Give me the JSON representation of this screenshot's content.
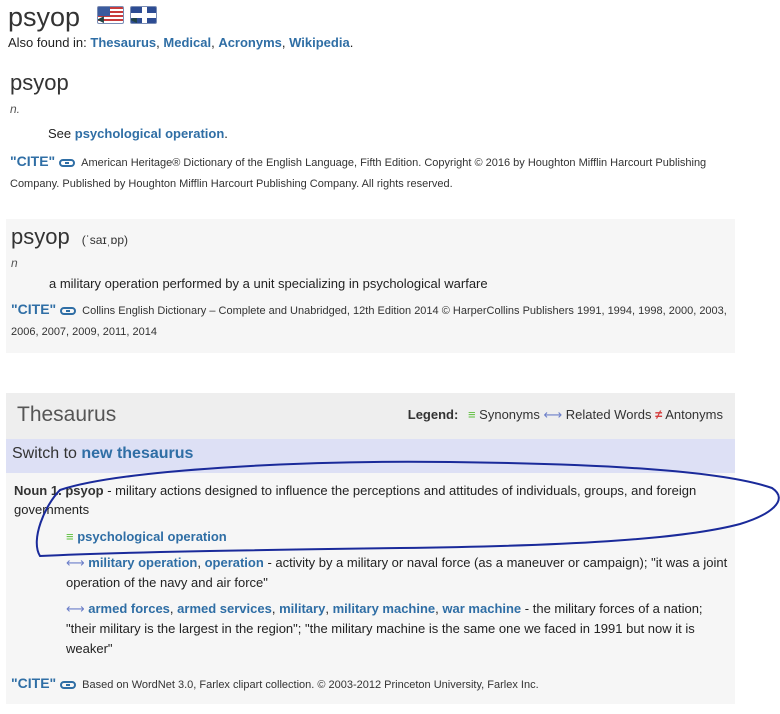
{
  "word": "psyop",
  "also_found": {
    "prefix": "Also found in:",
    "links": [
      "Thesaurus",
      "Medical",
      "Acronyms",
      "Wikipedia"
    ],
    "sep": ", ",
    "end": "."
  },
  "entry_ahd": {
    "headword": "psyop",
    "pos": "n.",
    "def_prefix": "See",
    "def_link": "psychological operation",
    "def_end": ".",
    "cite_label": "\"CITE\"",
    "cite_text": "American Heritage® Dictionary of the English Language, Fifth Edition. Copyright © 2016 by Houghton Mifflin Harcourt Publishing Company. Published by Houghton Mifflin Harcourt Publishing Company. All rights reserved."
  },
  "entry_collins": {
    "headword": "psyop",
    "pron": "(ˈsaɪˌɒp)",
    "pos": "n",
    "def": "a military operation performed by a unit specializing in psychological warfare",
    "cite_label": "\"CITE\"",
    "cite_text": "Collins English Dictionary – Complete and Unabridged, 12th Edition 2014 © HarperCollins Publishers 1991, 1994, 1998, 2000, 2003, 2006, 2007, 2009, 2011, 2014"
  },
  "thesaurus": {
    "title": "Thesaurus",
    "legend_label": "Legend:",
    "synonyms": "Synonyms",
    "related": "Related Words",
    "antonyms": "Antonyms",
    "switch_prefix": "Switch to",
    "switch_link": "new thesaurus",
    "sense_label": "Noun",
    "sense_num": "1.",
    "sense_word": "psyop",
    "sense_def": "- military actions designed to influence the perceptions and attitudes of individuals, groups, and foreign governments",
    "synonym": "psychological operation",
    "rel1_links": [
      "military operation",
      "operation"
    ],
    "rel1_def": "- activity by a military or naval force (as a maneuver or campaign); \"it was a joint operation of the navy and air force\"",
    "rel2_links": [
      "armed forces",
      "armed services",
      "military",
      "military machine",
      "war machine"
    ],
    "rel2_def": "- the military forces of a nation; \"their military is the largest in the region\"; \"the military machine is the same one we faced in 1991 but now it is weaker\"",
    "cite_label": "\"CITE\"",
    "cite_text": "Based on WordNet 3.0, Farlex clipart collection. © 2003-2012 Princeton University, Farlex Inc."
  },
  "colors": {
    "link": "#2f6ea5",
    "synonym_mark": "#5bbf3a",
    "antonym_mark": "#d43c3c",
    "related_mark": "#6c7fc9",
    "annotation_ink": "#1a2a9a"
  },
  "icons": {
    "speaker_us": "us-flag-speaker-icon",
    "speaker_uk": "uk-flag-speaker-icon",
    "cite_link": "chain-link-icon"
  }
}
